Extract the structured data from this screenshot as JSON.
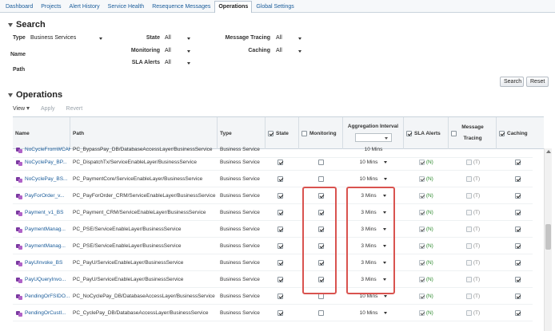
{
  "tabs": [
    "Dashboard",
    "Projects",
    "Alert History",
    "Service Health",
    "Resequence Messages",
    "Operations",
    "Global Settings"
  ],
  "active_tab": 5,
  "search": {
    "title": "Search",
    "type_label": "Type",
    "type_value": "Business Services",
    "name_label": "Name",
    "path_label": "Path",
    "state_label": "State",
    "state_value": "All",
    "monitoring_label": "Monitoring",
    "monitoring_value": "All",
    "sla_label": "SLA Alerts",
    "sla_value": "All",
    "tracing_label": "Message Tracing",
    "tracing_value": "All",
    "caching_label": "Caching",
    "caching_value": "All",
    "search_button": "Search",
    "reset_button": "Reset"
  },
  "operations": {
    "title": "Operations",
    "view_label": "View",
    "apply_label": "Apply",
    "revert_label": "Revert"
  },
  "columns": {
    "name": "Name",
    "path": "Path",
    "type": "Type",
    "state": "State",
    "monitoring": "Monitoring",
    "aggregation": "Aggregation Interval",
    "sla": "SLA Alerts",
    "tracing": "Message Tracing",
    "caching": "Caching"
  },
  "partial_row": {
    "name": "NoCycleFromWCAK...",
    "path": "PC_BypassPay_DB/DatabaseAccessLayer/BusinessService",
    "type": "Business Service",
    "agg": "10 Mins"
  },
  "rows": [
    {
      "name": "NoCyclePay_BP...",
      "path": "PC_DispatchTx/ServiceEnableLayer/BusinessService",
      "type": "Business Service",
      "state": true,
      "monitoring": false,
      "agg": "10 Mins",
      "sla": "(N)",
      "tracing": "(T)",
      "caching": true
    },
    {
      "name": "NoCyclePay_BS...",
      "path": "PC_PaymentCore/ServiceEnableLayer/BusinessService",
      "type": "Business Service",
      "state": true,
      "monitoring": false,
      "agg": "10 Mins",
      "sla": "(N)",
      "tracing": "(T)",
      "caching": true
    },
    {
      "name": "PayForOrder_v...",
      "path": "PC_PayForOrder_CRM/ServiceEnableLayer/BusinessService",
      "type": "Business Service",
      "state": true,
      "monitoring": true,
      "agg": "3 Mins",
      "sla": "(N)",
      "tracing": "(T)",
      "caching": true
    },
    {
      "name": "Payment_v1_BS",
      "path": "PC_Payment_CRM/ServiceEnableLayer/BusinessService",
      "type": "Business Service",
      "state": true,
      "monitoring": true,
      "agg": "3 Mins",
      "sla": "(N)",
      "tracing": "(T)",
      "caching": true
    },
    {
      "name": "PaymentManag...",
      "path": "PC_PSE/ServiceEnableLayer/BusinessService",
      "type": "Business Service",
      "state": true,
      "monitoring": true,
      "agg": "3 Mins",
      "sla": "(N)",
      "tracing": "(T)",
      "caching": true
    },
    {
      "name": "PaymentManag...",
      "path": "PC_PSE/ServiceEnableLayer/BusinessService",
      "type": "Business Service",
      "state": true,
      "monitoring": true,
      "agg": "3 Mins",
      "sla": "(N)",
      "tracing": "(T)",
      "caching": true
    },
    {
      "name": "PayUInvoke_BS",
      "path": "PC_PayU/ServiceEnableLayer/BusinessService",
      "type": "Business Service",
      "state": true,
      "monitoring": true,
      "agg": "3 Mins",
      "sla": "(N)",
      "tracing": "(T)",
      "caching": true
    },
    {
      "name": "PayUQueryInvo...",
      "path": "PC_PayU/ServiceEnableLayer/BusinessService",
      "type": "Business Service",
      "state": true,
      "monitoring": true,
      "agg": "3 Mins",
      "sla": "(N)",
      "tracing": "(T)",
      "caching": true
    },
    {
      "name": "PendingOrFSIDO...",
      "path": "PC_NoCyclePay_DB/DatabaseAccessLayer/BusinessService",
      "type": "Business Service",
      "state": true,
      "monitoring": false,
      "agg": "10 Mins",
      "sla": "(N)",
      "tracing": "(T)",
      "caching": true
    },
    {
      "name": "PendingOrCustI...",
      "path": "PC_CyclePay_DB/DatabaseAccessLayer/BusinessService",
      "type": "Business Service",
      "state": true,
      "monitoring": false,
      "agg": "10 Mins",
      "sla": "(N)",
      "tracing": "(T)",
      "caching": true
    }
  ],
  "highlight_color": "#d9534f"
}
